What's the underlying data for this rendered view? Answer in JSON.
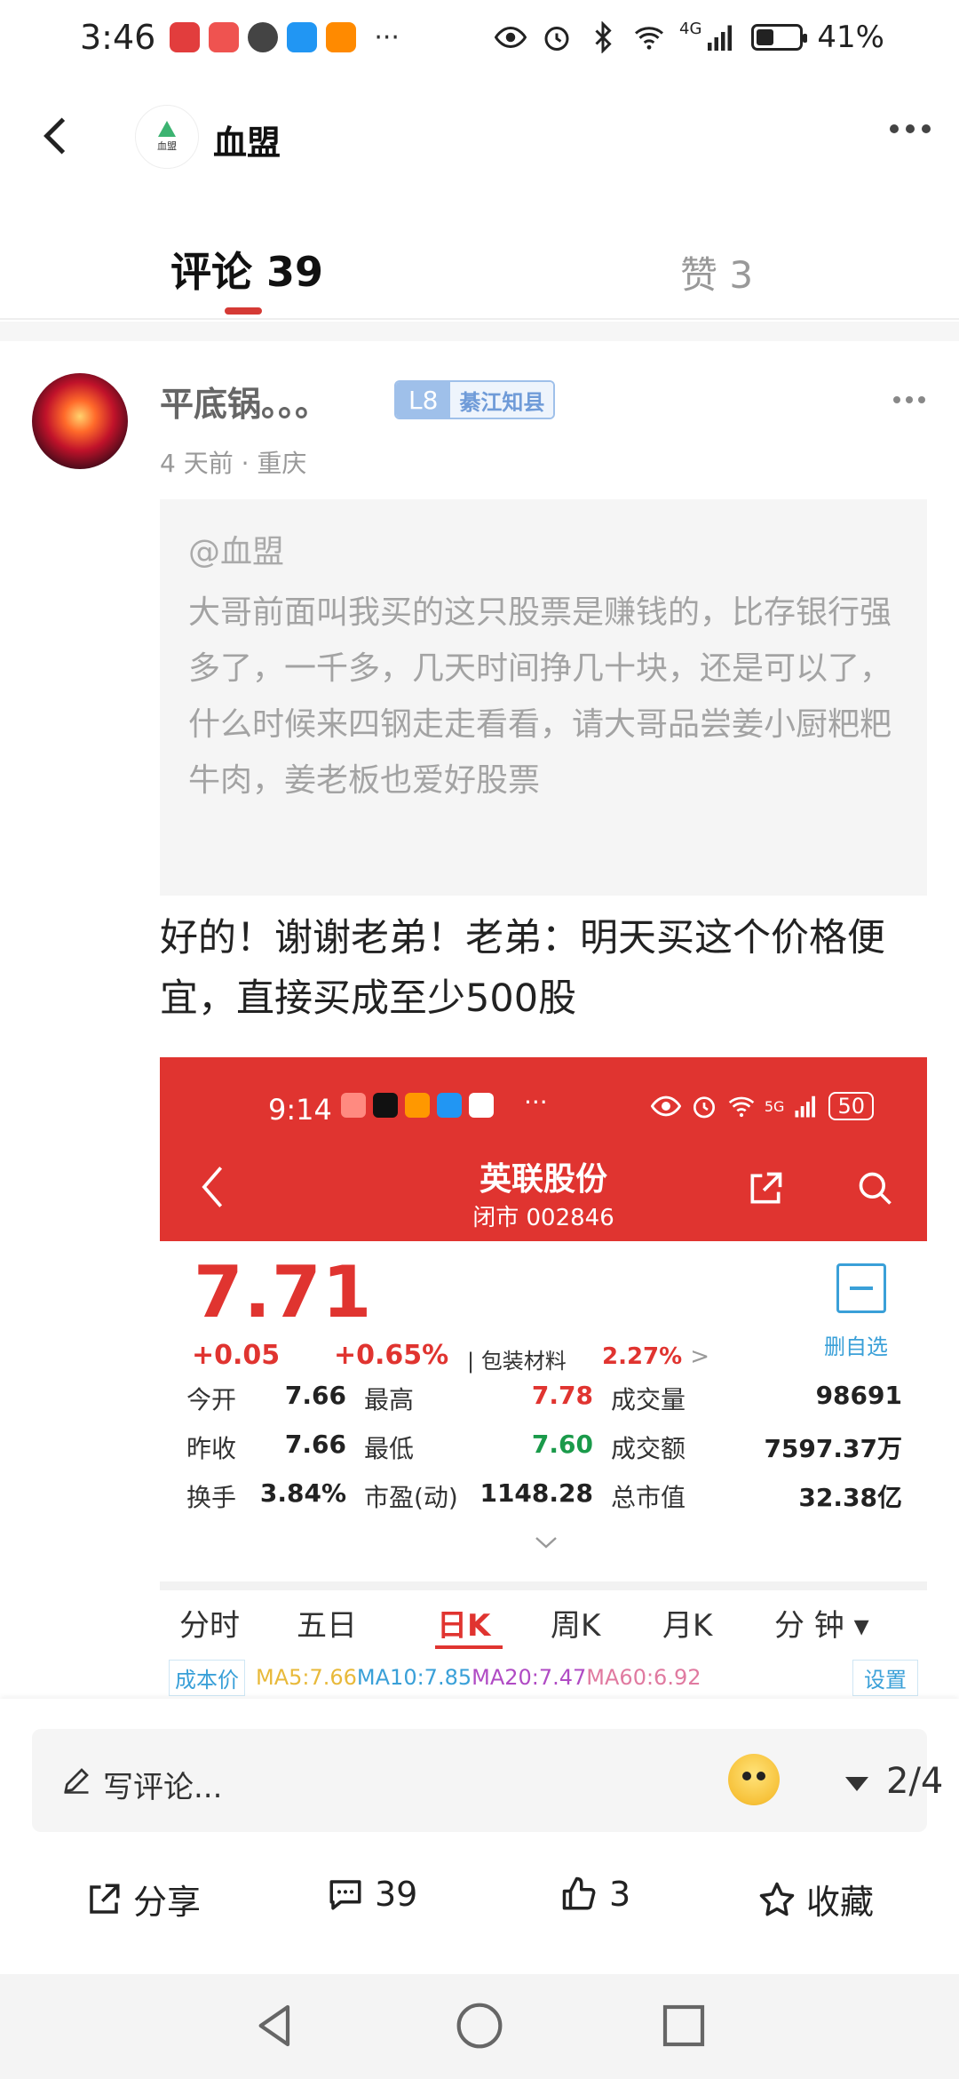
{
  "status_bar": {
    "time": "3:46",
    "more": "···",
    "battery": "41%",
    "battery_level": 0.41,
    "network": "4G"
  },
  "header": {
    "title": "血盟",
    "logo_text": "血盟"
  },
  "tabs": {
    "comments_label": "评论 39",
    "likes_label": "赞 3"
  },
  "comment": {
    "username": "平底锅。。。",
    "level": "L8",
    "level_title": "綦江知县",
    "time": "4 天前",
    "location": "重庆",
    "meta": "4 天前 · 重庆",
    "quote_mention": "@血盟",
    "quote_text": "大哥前面叫我买的这只股票是赚钱的，比存银行强多了，一千多，几天时间挣几十块，还是可以了，什么时候来四钢走走看看，请大哥品尝姜小厨粑粑牛肉，姜老板也爱好股票",
    "text": "好的！谢谢老弟！老弟：明天买这个价格便宜，直接买成至少500股"
  },
  "embedded_stock": {
    "status_time": "9:14",
    "status_more": "···",
    "status_5g": "5G",
    "status_battery": "50",
    "stock_name": "英联股份",
    "market_status": "闭市 002846",
    "price": "7.71",
    "change": "+0.05",
    "change_pct": "+0.65%",
    "sector": "| 包装材料",
    "sector_pct": "2.27%",
    "sector_arrow": ">",
    "watchlist_label": "删自选",
    "rows": [
      [
        {
          "label": "今开",
          "value": "7.66"
        },
        {
          "label": "最高",
          "value": "7.78"
        },
        {
          "label": "成交量",
          "value": "98691"
        }
      ],
      [
        {
          "label": "昨收",
          "value": "7.66"
        },
        {
          "label": "最低",
          "value": "7.60"
        },
        {
          "label": "成交额",
          "value": "7597.37万"
        }
      ],
      [
        {
          "label": "换手",
          "value": "3.84%"
        },
        {
          "label": "市盈(动)",
          "value": "1148.28"
        },
        {
          "label": "总市值",
          "value": "32.38亿"
        }
      ]
    ],
    "expand_icon": "chevron-down-icon",
    "chart_tabs": [
      "分时",
      "五日",
      "日K",
      "周K",
      "月K",
      "分 钟 ▾"
    ],
    "active_chart_tab": "日K",
    "ma_tag": "成本价",
    "ma_values": [
      {
        "label": "MA5:7.66",
        "color": "#e8b93a"
      },
      {
        "label": "MA10:7.85",
        "color": "#3aa0d8"
      },
      {
        "label": "MA20:7.47",
        "color": "#b04bc4"
      },
      {
        "label": "MA60:6.92",
        "color": "#e07aa0"
      }
    ],
    "ma_settings": "设置",
    "colors": {
      "up": "#e03430",
      "down": "#1a9a4a",
      "accent": "#3aa0d8"
    }
  },
  "bottom_bar": {
    "input_placeholder": "写评论...",
    "pager": "2/4",
    "share_label": "分享",
    "comment_count": "39",
    "like_count": "3",
    "favorite_label": "收藏"
  },
  "colors": {
    "accent_red": "#d53a35",
    "muted_text": "#999999"
  }
}
